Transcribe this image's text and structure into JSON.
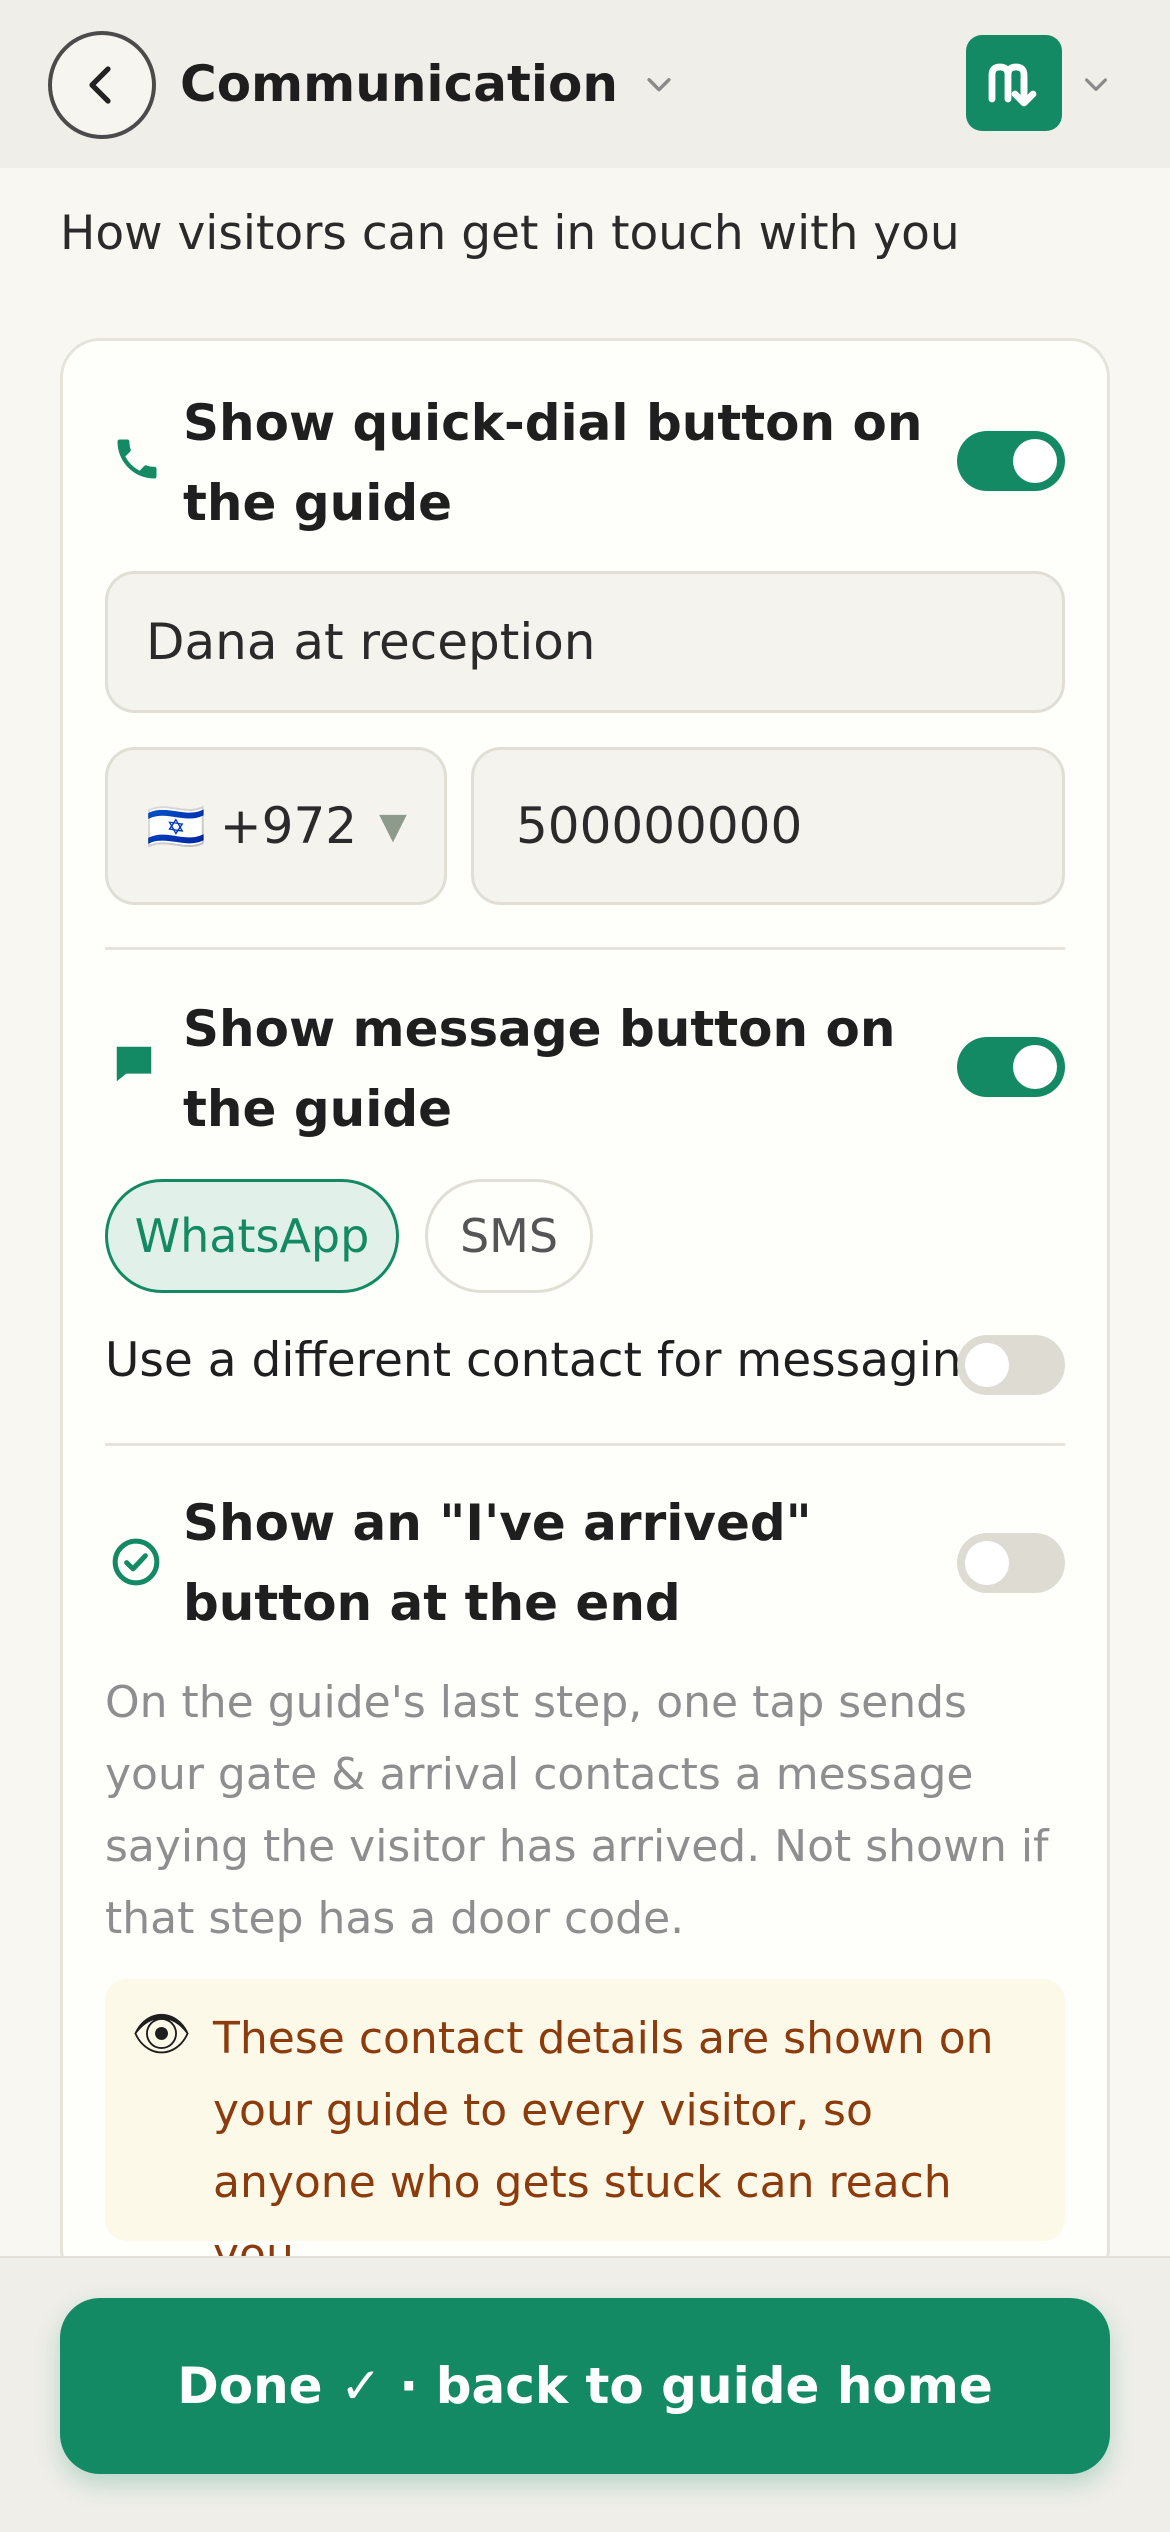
{
  "header": {
    "title": "Communication",
    "title_chevron_icon": "chevron-down-icon",
    "back_icon": "chevron-left-icon",
    "logo_icon": "brand-logo-icon",
    "logo_chevron_icon": "chevron-down-icon"
  },
  "subtitle": "How visitors can get in touch with you",
  "quick_dial": {
    "icon": "phone-icon",
    "title": "Show quick-dial button on the guide",
    "enabled": true,
    "name_value": "Dana at reception",
    "country_flag": "🇮🇱",
    "country_code": "+972",
    "country_caret": "▼",
    "phone_value": "500000000"
  },
  "message": {
    "icon": "message-icon",
    "title": "Show message button on the guide",
    "enabled": true,
    "options": [
      "WhatsApp",
      "SMS"
    ],
    "selected": "WhatsApp",
    "different_contact_label": "Use a different contact for messaging",
    "different_contact_enabled": false
  },
  "arrived": {
    "icon": "check-circle-icon",
    "title": "Show an \"I've arrived\" button at the end",
    "enabled": false,
    "help": "On the guide's last step, one tap sends your gate & arrival contacts a message saying the visitor has arrived. Not shown if that step has a door code."
  },
  "notice": {
    "icon": "eye-icon",
    "text": "These contact details are shown on your guide to every visitor, so anyone who gets stuck can reach you."
  },
  "footer": {
    "done_label": "Done ✓ · back to guide home"
  },
  "colors": {
    "accent": "#138a63",
    "notice_text": "#8c3b0c",
    "notice_bg": "#fdf9e9"
  }
}
